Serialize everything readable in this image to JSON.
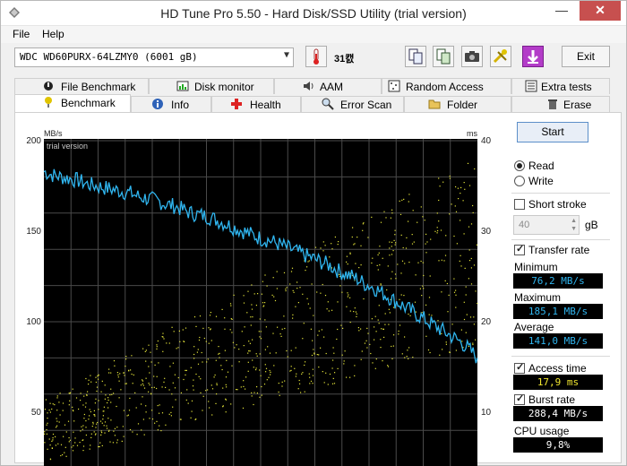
{
  "window": {
    "title": "HD Tune Pro 5.50 - Hard Disk/SSD Utility (trial version)",
    "minimize_label": "—",
    "close_label": "✕"
  },
  "menu": {
    "file": "File",
    "help": "Help"
  },
  "toolbar": {
    "drive": "WDC WD60PURX-64LZMY0 (6001 gB)",
    "temperature": "31캜",
    "exit_label": "Exit"
  },
  "tabs_top": [
    "File Benchmark",
    "Disk monitor",
    "AAM",
    "Random Access",
    "Extra tests"
  ],
  "tabs_bottom": [
    "Benchmark",
    "Info",
    "Health",
    "Error Scan",
    "Folder Usage",
    "Erase"
  ],
  "controls": {
    "start_label": "Start",
    "read_label": "Read",
    "write_label": "Write",
    "short_stroke_label": "Short stroke",
    "stroke_value": "40",
    "stroke_unit": "gB",
    "transfer_rate_label": "Transfer rate",
    "access_time_label": "Access time",
    "burst_rate_label": "Burst rate",
    "cpu_usage_label": "CPU usage"
  },
  "stats": {
    "minimum_label": "Minimum",
    "minimum": "76,2 MB/s",
    "maximum_label": "Maximum",
    "maximum": "185,1 MB/s",
    "average_label": "Average",
    "average": "141,0 MB/s",
    "access_time": "17,9 ms",
    "burst_rate": "288,4 MB/s",
    "cpu_usage": "9,8%"
  },
  "colors": {
    "transfer_line": "#30b6f0",
    "access_dots": "#e6e63a",
    "chart_bg": "#000000",
    "grid": "#4a4a4a"
  },
  "chart_data": {
    "type": "line",
    "watermark": "trial version",
    "ylabel_left": "MB/s",
    "ylabel_right": "ms",
    "y_left_ticks": [
      200,
      150,
      100,
      50
    ],
    "y_right_ticks": [
      40,
      30,
      20,
      10
    ],
    "ylim_left": [
      0,
      200
    ],
    "ylim_right": [
      0,
      40
    ],
    "grid": true,
    "series": [
      {
        "x": [
          0,
          2,
          4,
          6,
          8,
          10,
          12,
          14,
          16,
          18,
          20,
          22,
          24,
          26,
          28,
          30,
          32,
          34,
          36,
          38,
          40,
          42,
          44,
          46,
          48,
          50,
          52,
          54,
          56,
          58,
          60,
          62,
          64,
          66,
          68,
          70,
          72,
          74,
          76,
          78,
          80,
          82,
          84,
          86,
          88,
          90,
          92,
          94,
          96,
          98,
          100
        ],
        "values": [
          183,
          181,
          180,
          179,
          178,
          176,
          175,
          174,
          173,
          172,
          171,
          169,
          168,
          167,
          165,
          164,
          162,
          160,
          159,
          158,
          156,
          154,
          152,
          150,
          148,
          146,
          145,
          143,
          141,
          139,
          137,
          135,
          133,
          131,
          128,
          126,
          124,
          121,
          119,
          116,
          113,
          110,
          107,
          104,
          101,
          98,
          95,
          92,
          89,
          85,
          80
        ]
      }
    ]
  }
}
